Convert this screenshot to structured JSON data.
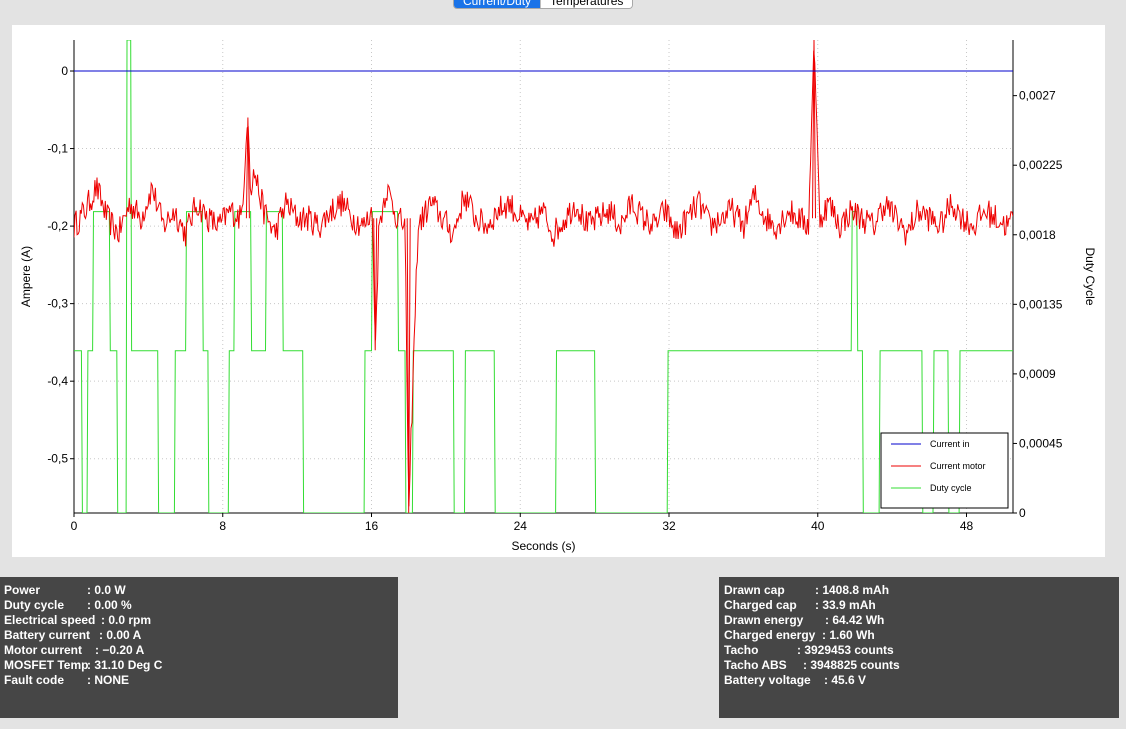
{
  "tabs": [
    {
      "label": "Current/Duty",
      "active": true
    },
    {
      "label": "Temperatures",
      "active": false
    }
  ],
  "chart_data": {
    "type": "line",
    "xlabel": "Seconds (s)",
    "ylabel": "Ampere (A)",
    "y2label": "Duty Cycle",
    "xlim": [
      0,
      50.5
    ],
    "ylim": [
      -0.57,
      0.04
    ],
    "y2lim": [
      0,
      0.00306
    ],
    "x_ticks": [
      "0",
      "8",
      "16",
      "24",
      "32",
      "40",
      "48"
    ],
    "y_ticks": [
      "0",
      "-0,1",
      "-0,2",
      "-0,3",
      "-0,4",
      "-0,5"
    ],
    "y2_ticks": [
      "0",
      "0,00045",
      "0,0009",
      "0,00135",
      "0,0018",
      "0,00225",
      "0,0027"
    ],
    "grid": true,
    "legend_position": "bottom-right",
    "series": [
      {
        "name": "Current in",
        "axis": "left",
        "color": "#0000cc",
        "x": [
          0,
          50.5
        ],
        "y": [
          0,
          0
        ]
      },
      {
        "name": "Current motor",
        "axis": "left",
        "color": "#ee0000",
        "base": -0.19,
        "noise": 0.018,
        "x": [
          0,
          0.6,
          1.2,
          1.8,
          2.4,
          3.0,
          3.6,
          4.2,
          4.8,
          5.4,
          6.0,
          6.6,
          7.2,
          7.8,
          8.4,
          9.0,
          9.35,
          9.5,
          9.7,
          10.2,
          10.8,
          11.4,
          12.0,
          12.6,
          13.2,
          13.8,
          14.4,
          15.0,
          15.6,
          16.05,
          16.2,
          16.4,
          16.8,
          17.4,
          17.8,
          18.0,
          18.5,
          19.2,
          19.8,
          20.4,
          21.0,
          21.6,
          22.2,
          22.8,
          23.4,
          24.0,
          24.6,
          25.2,
          25.8,
          26.4,
          27.0,
          27.6,
          28.2,
          28.8,
          29.4,
          30.0,
          30.6,
          31.2,
          31.8,
          32.4,
          33.0,
          33.6,
          34.2,
          34.8,
          35.4,
          36.0,
          36.6,
          37.2,
          37.8,
          38.4,
          39.0,
          39.5,
          39.8,
          40.1,
          40.6,
          41.2,
          41.8,
          42.4,
          43.0,
          43.6,
          44.2,
          44.8,
          45.4,
          46.0,
          46.6,
          47.2,
          47.8,
          48.4,
          49.0,
          49.6,
          50.2,
          50.5
        ],
        "y": [
          -0.2,
          -0.18,
          -0.15,
          -0.19,
          -0.21,
          -0.17,
          -0.19,
          -0.15,
          -0.2,
          -0.18,
          -0.21,
          -0.17,
          -0.19,
          -0.2,
          -0.18,
          -0.19,
          -0.06,
          -0.15,
          -0.13,
          -0.18,
          -0.21,
          -0.17,
          -0.19,
          -0.19,
          -0.2,
          -0.18,
          -0.17,
          -0.19,
          -0.2,
          -0.18,
          -0.36,
          -0.2,
          -0.15,
          -0.19,
          -0.2,
          -0.57,
          -0.2,
          -0.17,
          -0.19,
          -0.21,
          -0.16,
          -0.19,
          -0.2,
          -0.18,
          -0.17,
          -0.19,
          -0.2,
          -0.18,
          -0.21,
          -0.19,
          -0.17,
          -0.2,
          -0.19,
          -0.18,
          -0.2,
          -0.17,
          -0.19,
          -0.2,
          -0.18,
          -0.21,
          -0.19,
          -0.17,
          -0.2,
          -0.19,
          -0.18,
          -0.2,
          -0.16,
          -0.19,
          -0.2,
          -0.18,
          -0.19,
          -0.2,
          0.04,
          -0.19,
          -0.17,
          -0.2,
          -0.18,
          -0.19,
          -0.2,
          -0.17,
          -0.19,
          -0.21,
          -0.18,
          -0.19,
          -0.2,
          -0.17,
          -0.19,
          -0.2,
          -0.18,
          -0.19,
          -0.2,
          -0.19
        ]
      },
      {
        "name": "Duty cycle",
        "axis": "right",
        "color": "#33dd33",
        "x": [
          0,
          0.4,
          0.45,
          0.7,
          0.75,
          1.0,
          1.05,
          1.9,
          1.95,
          2.3,
          2.35,
          2.8,
          2.85,
          3.05,
          3.1,
          4.5,
          4.55,
          5.4,
          5.45,
          6.0,
          6.05,
          6.9,
          6.95,
          7.2,
          7.25,
          8.3,
          8.35,
          8.6,
          8.65,
          9.5,
          9.55,
          10.3,
          10.35,
          11.2,
          11.25,
          12.3,
          12.35,
          15.6,
          15.65,
          16.0,
          16.05,
          17.4,
          17.45,
          17.8,
          17.85,
          18.2,
          18.25,
          20.4,
          20.45,
          21.0,
          21.05,
          22.6,
          22.65,
          25.9,
          25.95,
          28.0,
          28.05,
          31.9,
          31.95,
          36.1,
          36.15,
          41.8,
          41.85,
          42.1,
          42.15,
          42.4,
          42.45,
          43.3,
          43.35,
          45.6,
          45.65,
          46.2,
          46.25,
          47.0,
          47.05,
          47.6,
          47.65,
          50.5
        ],
        "y": [
          0.00105,
          0.00105,
          0,
          0,
          0.00105,
          0.00105,
          0.00195,
          0.00195,
          0.00105,
          0.00105,
          0,
          0,
          0.00306,
          0.00306,
          0.00105,
          0.00105,
          0,
          0,
          0.00105,
          0.00105,
          0.00195,
          0.00195,
          0.00105,
          0.00105,
          0,
          0,
          0.00105,
          0.00105,
          0.00195,
          0.00195,
          0.00105,
          0.00105,
          0.00195,
          0.00195,
          0.00105,
          0.00105,
          0,
          0,
          0.00105,
          0.00105,
          0.00195,
          0.00195,
          0.00105,
          0.00105,
          0,
          0,
          0.00105,
          0.00105,
          0,
          0,
          0.00105,
          0.00105,
          0,
          0,
          0.00105,
          0.00105,
          0,
          0,
          0.00105,
          0.00105,
          0.00105,
          0.00105,
          0.00195,
          0.00195,
          0.00105,
          0.00105,
          0,
          0,
          0.00105,
          0.00105,
          0,
          0,
          0.00105,
          0.00105,
          0,
          0,
          0.00105,
          0.00105
        ]
      }
    ]
  },
  "info_left": [
    {
      "key": "Power",
      "value": ": 0.0 W"
    },
    {
      "key": "Duty cycle",
      "value": ": 0.00 %"
    },
    {
      "key": "Electrical speed",
      "value": ": 0.0 rpm"
    },
    {
      "key": "Battery current",
      "value": ": 0.00 A"
    },
    {
      "key": "Motor current",
      "value": ": −0.20 A"
    },
    {
      "key": "MOSFET Temp",
      "value": ": 31.10 Deg C"
    },
    {
      "key": "Fault code",
      "value": ": NONE"
    }
  ],
  "info_right": [
    {
      "key": "Drawn cap",
      "value": ": 1408.8 mAh"
    },
    {
      "key": "Charged cap",
      "value": ": 33.9 mAh"
    },
    {
      "key": "Drawn energy",
      "value": ": 64.42 Wh"
    },
    {
      "key": "Charged energy",
      "value": ": 1.60 Wh"
    },
    {
      "key": "Tacho",
      "value": ": 3929453 counts"
    },
    {
      "key": "Tacho ABS",
      "value": ": 3948825 counts"
    },
    {
      "key": "Battery voltage",
      "value": ": 45.6 V"
    }
  ]
}
